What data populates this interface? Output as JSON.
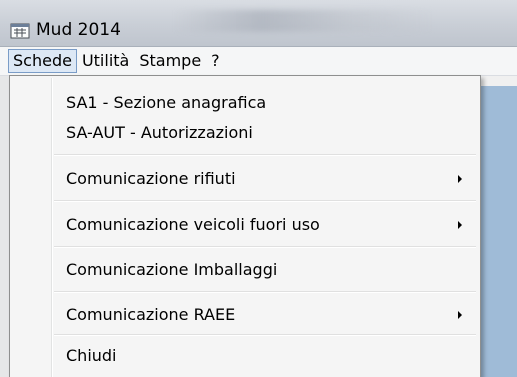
{
  "window": {
    "title": "Mud 2014",
    "icon": "app-window-icon"
  },
  "menubar": {
    "items": [
      {
        "label": "Schede",
        "active": true
      },
      {
        "label": "Utilità",
        "active": false
      },
      {
        "label": "Stampe",
        "active": false
      },
      {
        "label": "?",
        "active": false
      }
    ]
  },
  "dropdown": {
    "items": [
      {
        "label": "SA1 - Sezione anagrafica",
        "has_submenu": false
      },
      {
        "label": "SA-AUT - Autorizzazioni",
        "has_submenu": false
      },
      {
        "label": "Comunicazione rifiuti",
        "has_submenu": true
      },
      {
        "label": "Comunicazione veicoli fuori uso",
        "has_submenu": true
      },
      {
        "label": "Comunicazione Imballaggi",
        "has_submenu": false
      },
      {
        "label": "Comunicazione RAEE",
        "has_submenu": true
      },
      {
        "label": "Chiudi",
        "has_submenu": false
      }
    ]
  },
  "colors": {
    "workspace": "#9fbbd7",
    "menu_highlight_border": "#7a9cc7",
    "menu_background": "#f5f5f5"
  }
}
